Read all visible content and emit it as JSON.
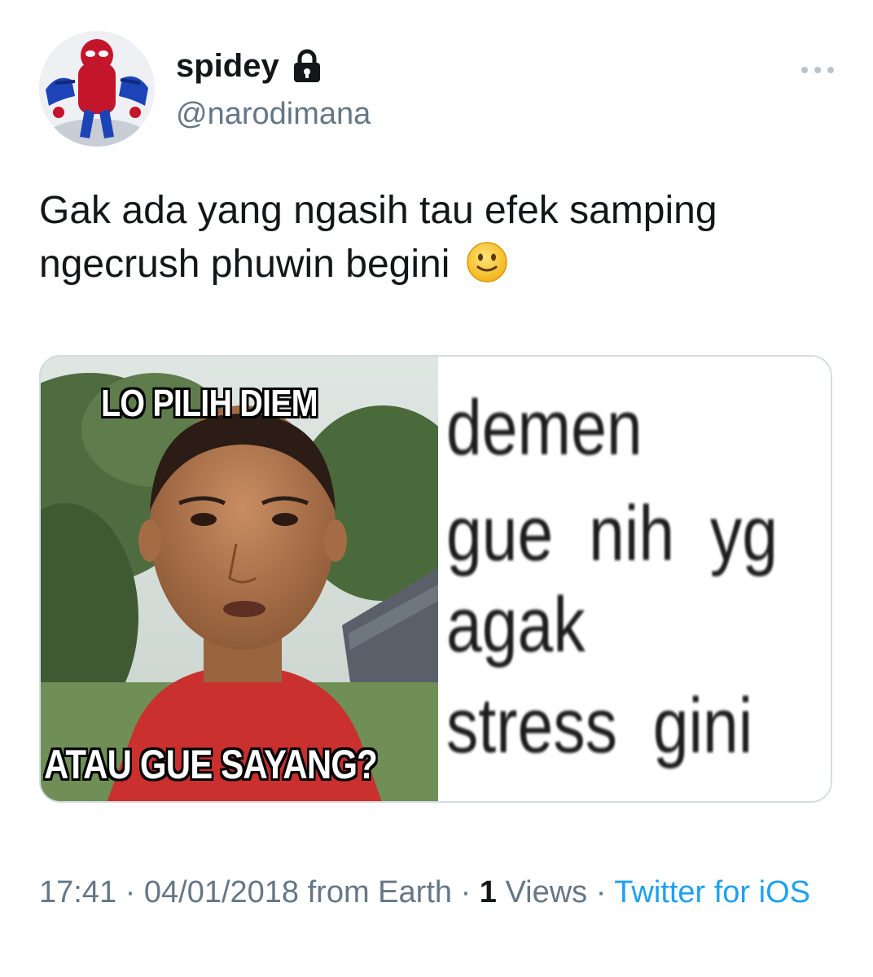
{
  "user": {
    "display_name": "spidey",
    "handle": "@narodimana",
    "protected_icon": "lock-icon",
    "avatar_icon": "spiderman-toy-avatar"
  },
  "tweet": {
    "text": "Gak ada yang ngasih tau efek samping ngecrush phuwin begini",
    "emoji": "slightly-smiling-face-icon"
  },
  "media": {
    "meme_top_caption": "LO PILIH DIEM",
    "meme_bottom_caption": "ATAU GUE SAYANG?",
    "text_lines": [
      "demen",
      "gue  nih  yg",
      "agak",
      "stress  gini"
    ]
  },
  "meta": {
    "time": "17:41",
    "date": "04/01/2018",
    "location": "from Earth",
    "views_count": "1",
    "views_label": "Views",
    "separator": " · ",
    "source": "Twitter for iOS"
  },
  "colors": {
    "text": "#14171a",
    "secondary": "#657786",
    "link": "#1da1f2",
    "card_border": "#d5dce2"
  }
}
